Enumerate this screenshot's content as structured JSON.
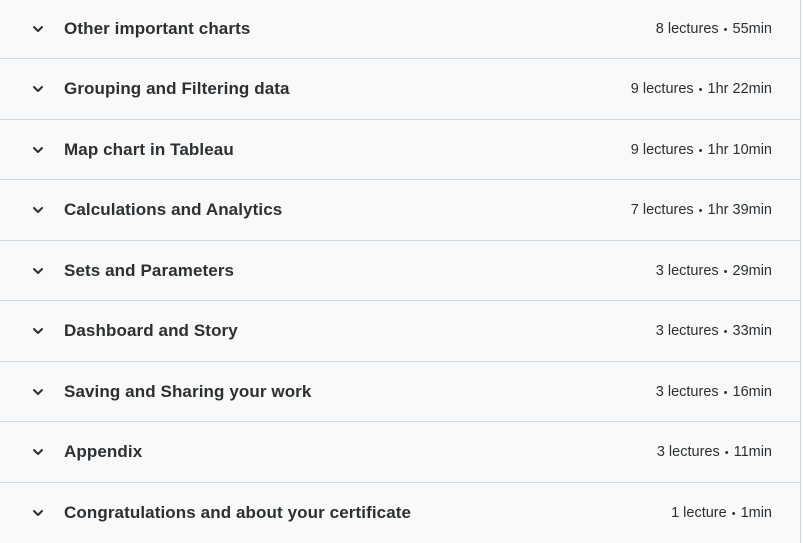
{
  "sections": [
    {
      "title": "Other important charts",
      "lectures": "8 lectures",
      "duration": "55min"
    },
    {
      "title": "Grouping and Filtering data",
      "lectures": "9 lectures",
      "duration": "1hr 22min"
    },
    {
      "title": "Map chart in Tableau",
      "lectures": "9 lectures",
      "duration": "1hr 10min"
    },
    {
      "title": "Calculations and Analytics",
      "lectures": "7 lectures",
      "duration": "1hr 39min"
    },
    {
      "title": "Sets and Parameters",
      "lectures": "3 lectures",
      "duration": "29min"
    },
    {
      "title": "Dashboard and Story",
      "lectures": "3 lectures",
      "duration": "33min"
    },
    {
      "title": "Saving and Sharing your work",
      "lectures": "3 lectures",
      "duration": "16min"
    },
    {
      "title": "Appendix",
      "lectures": "3 lectures",
      "duration": "11min"
    },
    {
      "title": "Congratulations and about your certificate",
      "lectures": "1 lecture",
      "duration": "1min"
    }
  ],
  "separator": "•",
  "icons": {
    "expand": "chevron-down-icon"
  }
}
